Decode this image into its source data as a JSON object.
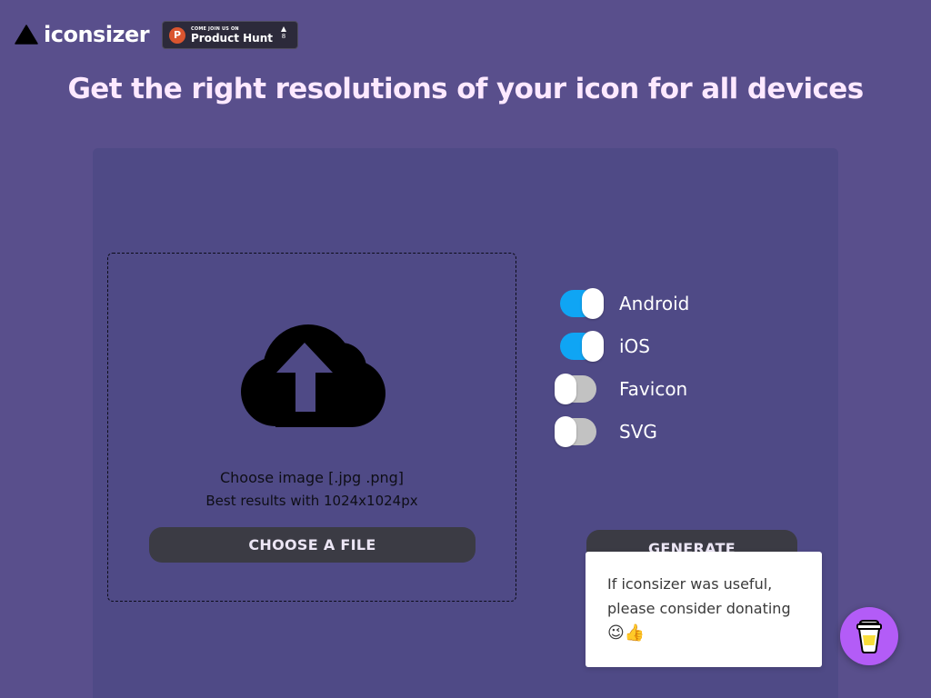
{
  "header": {
    "logo_text": "iconsizer",
    "product_hunt": {
      "small_text": "COME JOIN US ON",
      "name": "Product Hunt",
      "logo_letter": "P",
      "votes": "8"
    },
    "headline": "Get the right resolutions of your icon for all devices"
  },
  "upload": {
    "line1": "Choose image [.jpg .png]",
    "line2": "Best results with 1024x1024px",
    "choose_button": "CHOOSE A FILE",
    "icon": "cloud-upload-icon"
  },
  "platforms": [
    {
      "label": "Android",
      "enabled": true
    },
    {
      "label": "iOS",
      "enabled": true
    },
    {
      "label": "Favicon",
      "enabled": false
    },
    {
      "label": "SVG",
      "enabled": false
    }
  ],
  "generate_button": "GENERATE",
  "donate": {
    "line1": "If iconsizer was useful,",
    "line2": "please consider donating",
    "emoji": "😉👍"
  },
  "coffee_icon": "coffee-cup-icon",
  "colors": {
    "background": "#594f8c",
    "card": "#4f4a86",
    "toggle_on": "#0fa5f4",
    "toggle_off": "#c2c2c2",
    "button": "#3b3b44",
    "coffee": "#b35cf7"
  }
}
